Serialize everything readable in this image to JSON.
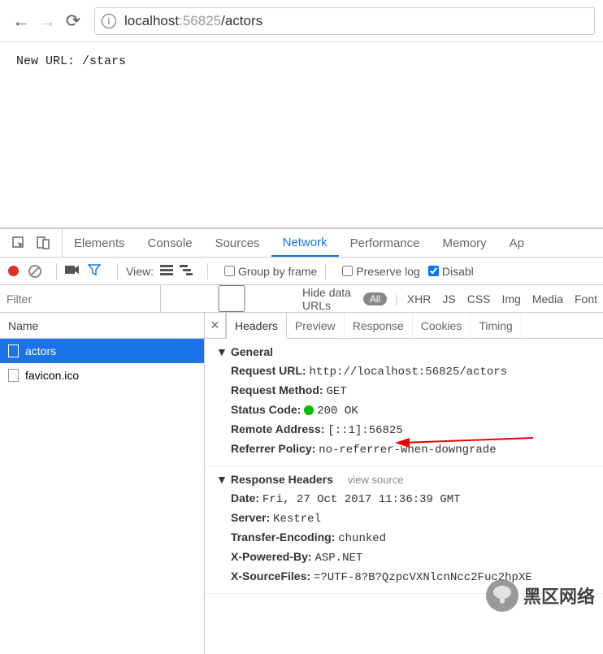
{
  "browser": {
    "url_host": "localhost",
    "url_port": ":56825",
    "url_path": "/actors"
  },
  "page": {
    "body": "New URL: /stars"
  },
  "devtools": {
    "tabs": [
      "Elements",
      "Console",
      "Sources",
      "Network",
      "Performance",
      "Memory",
      "Ap"
    ],
    "active_tab": "Network",
    "toolbar": {
      "view_label": "View:",
      "group_by_frame": "Group by frame",
      "preserve_log": "Preserve log",
      "disable_cache": "Disabl"
    },
    "filter": {
      "placeholder": "Filter",
      "hide_data_urls": "Hide data URLs",
      "all_label": "All",
      "types": [
        "XHR",
        "JS",
        "CSS",
        "Img",
        "Media",
        "Font"
      ]
    },
    "list": {
      "header": "Name",
      "items": [
        {
          "name": "actors",
          "selected": true
        },
        {
          "name": "favicon.ico",
          "selected": false
        }
      ]
    },
    "detail_tabs": [
      "Headers",
      "Preview",
      "Response",
      "Cookies",
      "Timing"
    ],
    "active_detail": "Headers",
    "general": {
      "title": "General",
      "request_url_k": "Request URL:",
      "request_url_v": "http://localhost:56825/actors",
      "request_method_k": "Request Method:",
      "request_method_v": "GET",
      "status_code_k": "Status Code:",
      "status_code_v": "200 OK",
      "remote_k": "Remote Address:",
      "remote_v": "[::1]:56825",
      "referrer_k": "Referrer Policy:",
      "referrer_v": "no-referrer-when-downgrade"
    },
    "response": {
      "title": "Response Headers",
      "view_source": "view source",
      "date_k": "Date:",
      "date_v": "Fri, 27 Oct 2017 11:36:39 GMT",
      "server_k": "Server:",
      "server_v": "Kestrel",
      "te_k": "Transfer-Encoding:",
      "te_v": "chunked",
      "xpb_k": "X-Powered-By:",
      "xpb_v": "ASP.NET",
      "xsf_k": "X-SourceFiles:",
      "xsf_v": "=?UTF-8?B?QzpcVXNlcnNcc2Fuc2hpXE"
    }
  },
  "watermark": "黑区网络"
}
